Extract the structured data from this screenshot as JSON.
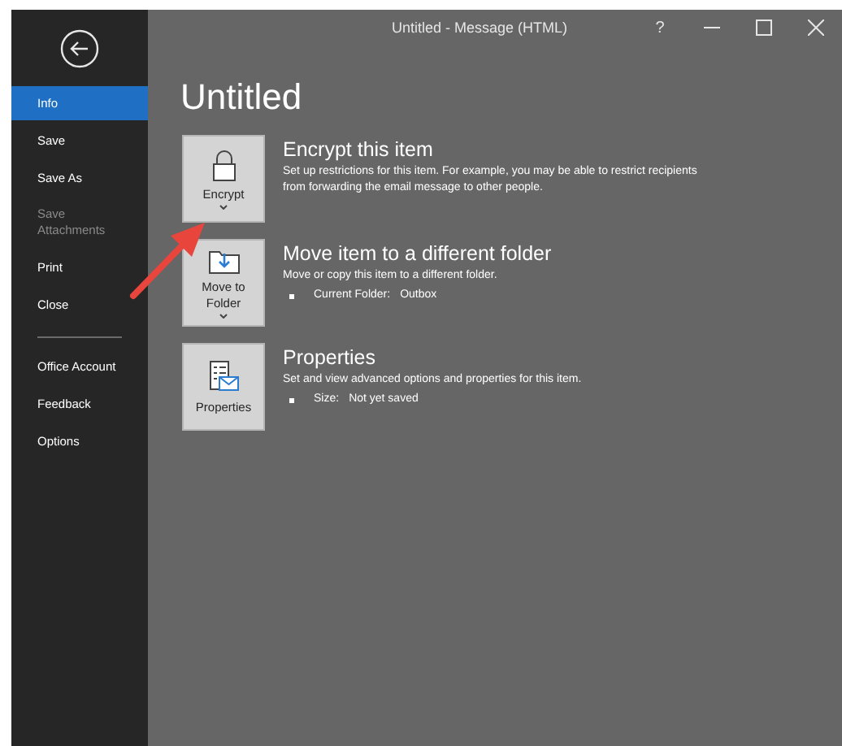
{
  "window": {
    "title": "Untitled  -  Message (HTML)",
    "controls": [
      {
        "kind": "help",
        "label": "?"
      },
      {
        "kind": "minimize"
      },
      {
        "kind": "maximize"
      },
      {
        "kind": "close"
      }
    ]
  },
  "sidebar": {
    "items": [
      {
        "kind": "item",
        "label": "Info",
        "selected": true,
        "disabled": false
      },
      {
        "kind": "item",
        "label": "Save",
        "selected": false,
        "disabled": false
      },
      {
        "kind": "item",
        "label": "Save As",
        "selected": false,
        "disabled": false
      },
      {
        "kind": "item",
        "label": "Save Attachments",
        "selected": false,
        "disabled": true
      },
      {
        "kind": "item",
        "label": "Print",
        "selected": false,
        "disabled": false
      },
      {
        "kind": "item",
        "label": "Close",
        "selected": false,
        "disabled": false
      },
      {
        "kind": "divider"
      },
      {
        "kind": "item",
        "label": "Office Account",
        "selected": false,
        "disabled": false
      },
      {
        "kind": "item",
        "label": "Feedback",
        "selected": false,
        "disabled": false
      },
      {
        "kind": "item",
        "label": "Options",
        "selected": false,
        "disabled": false
      }
    ]
  },
  "heading": "Untitled",
  "sections": [
    {
      "kind": "encrypt",
      "button": "Encrypt",
      "dropdown": true,
      "title": "Encrypt this item",
      "description": "Set up restrictions for this item. For example, you may be able to restrict recipients from forwarding the email message to other people."
    },
    {
      "kind": "move",
      "button": "Move to Folder",
      "dropdown": true,
      "title": "Move item to a different folder",
      "description": "Move or copy this item to a different folder.",
      "details": [
        {
          "label": "Current Folder:",
          "value": "Outbox"
        }
      ]
    },
    {
      "kind": "properties",
      "button": "Properties",
      "dropdown": false,
      "title": "Properties",
      "description": "Set and view advanced options and properties for this item.",
      "details": [
        {
          "label": "Size:",
          "value": "Not yet saved"
        }
      ]
    }
  ],
  "annotation": {
    "kind": "arrow"
  }
}
